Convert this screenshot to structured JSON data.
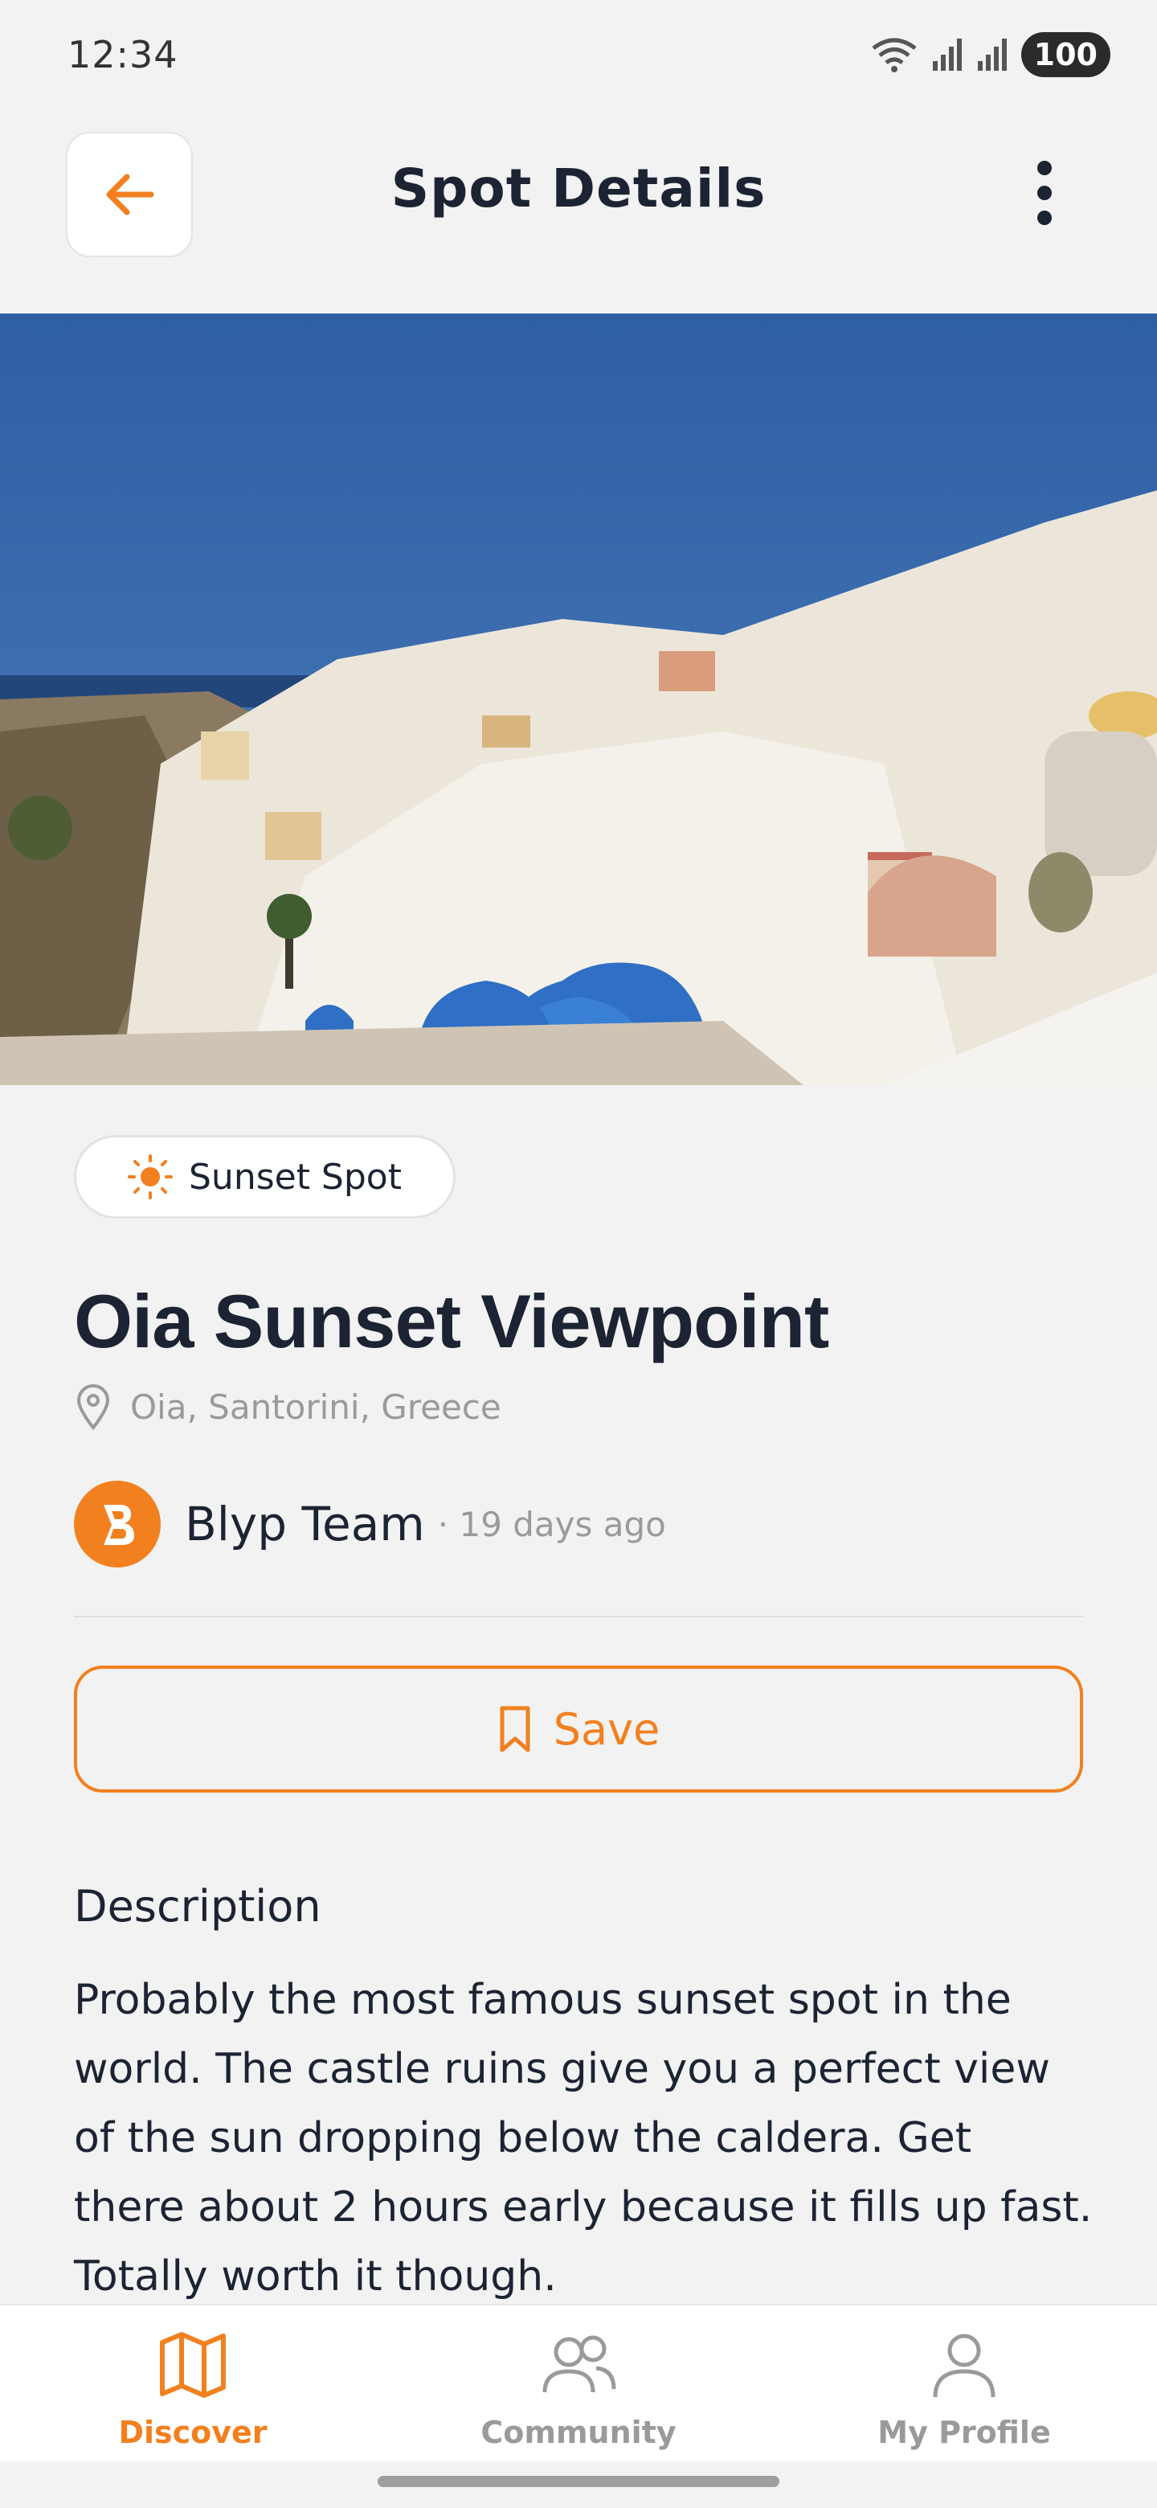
{
  "status_bar": {
    "time": "12:34",
    "battery": "100",
    "icons": [
      "wifi-icon",
      "signal-icon",
      "signal-icon",
      "battery-icon"
    ]
  },
  "header": {
    "title": "Spot Details",
    "back_icon": "arrow-left-icon",
    "menu_icon": "more-vertical-icon"
  },
  "spot": {
    "category": "Sunset Spot",
    "category_icon": "sun-icon",
    "title": "Oia Sunset Viewpoint",
    "location": "Oia, Santorini, Greece",
    "author": "Blyp Team",
    "posted": "· 19 days ago"
  },
  "actions": {
    "save_label": "Save"
  },
  "description": {
    "heading": "Description",
    "text": "Probably the most famous sunset spot in the world. The castle ruins give you a perfect view of the sun dropping below the caldera. Get there about 2 hours early because it fills up fast. Totally worth it though."
  },
  "nav": {
    "items": [
      {
        "label": "Discover",
        "icon": "map-icon",
        "active": true
      },
      {
        "label": "Community",
        "icon": "users-icon",
        "active": false
      },
      {
        "label": "My Profile",
        "icon": "user-icon",
        "active": false
      }
    ]
  },
  "colors": {
    "accent": "#f2801f",
    "text": "#1c2333",
    "muted": "#9a9a9a",
    "background": "#f2f2f2"
  }
}
